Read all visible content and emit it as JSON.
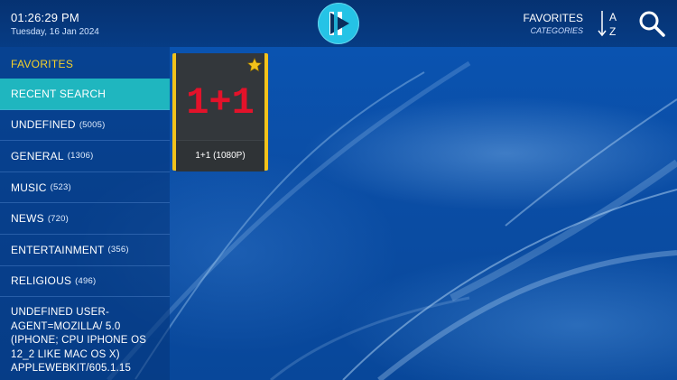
{
  "header": {
    "time": "01:26:29 PM",
    "date": "Tuesday, 16 Jan 2024",
    "section_title": "FAVORITES",
    "section_subtitle": "CATEGORIES"
  },
  "sidebar": {
    "heading": "FAVORITES",
    "items": [
      {
        "label": "RECENT SEARCH",
        "count": ""
      },
      {
        "label": "UNDEFINED",
        "count": "(5005)"
      },
      {
        "label": "GENERAL",
        "count": "(1306)"
      },
      {
        "label": "MUSIC",
        "count": "(523)"
      },
      {
        "label": "NEWS",
        "count": "(720)"
      },
      {
        "label": "ENTERTAINMENT",
        "count": "(356)"
      },
      {
        "label": "RELIGIOUS",
        "count": "(496)"
      },
      {
        "label": "UNDEFINED USER-AGENT=MOZILLA/ 5.0 (IPHONE; CPU IPHONE OS 12_2 LIKE MAC OS X) APPLEWEBKIT/605.1.15",
        "count": ""
      }
    ]
  },
  "channels": [
    {
      "logo_text": "1+1",
      "label": "1+1 (1080P)",
      "favorite": true
    }
  ],
  "colors": {
    "accent": "#1fb6bf",
    "highlight_yellow": "#f6d22a",
    "logo_cyan": "#25c3e6",
    "channel_logo_red": "#e3122a"
  },
  "icons": {
    "logo": "play-logo-icon",
    "sort": "sort-az-icon",
    "search": "search-icon",
    "favorite": "star-icon"
  }
}
